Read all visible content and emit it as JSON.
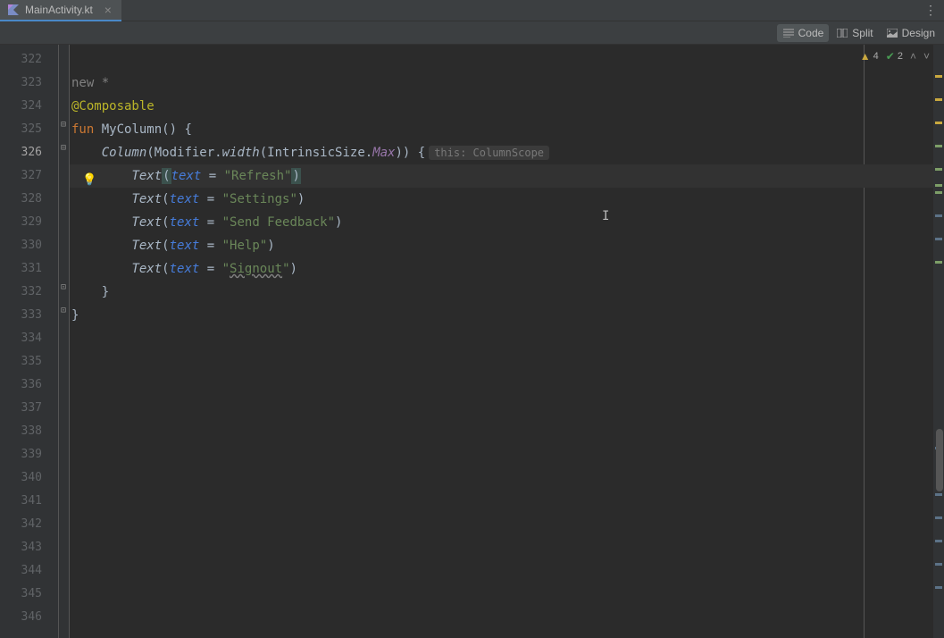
{
  "tab": {
    "filename": "MainActivity.kt"
  },
  "views": {
    "code": "Code",
    "split": "Split",
    "design": "Design"
  },
  "status": {
    "warnings": "4",
    "checks": "2"
  },
  "gutter": {
    "start": 322,
    "end": 346,
    "active": 326
  },
  "code": {
    "l322": "",
    "l323_comment": "new *",
    "l324_annotation": "@Composable",
    "l325_fun": "fun",
    "l325_name": "MyColumn",
    "l325_rest": "() {",
    "l326_column": "Column",
    "l326_modifier": "(Modifier.",
    "l326_width": "width",
    "l326_intrinsic": "(IntrinsicSize.",
    "l326_max": "Max",
    "l326_close": ")) {",
    "l326_hint": "this: ColumnScope",
    "l327_text": "Text",
    "l327_param": "text",
    "l327_eq": " = ",
    "l327_str": "\"Refresh\"",
    "l328_str": "\"Settings\"",
    "l329_str": "\"Send Feedback\"",
    "l330_str": "\"Help\"",
    "l331_str_open": "\"",
    "l331_signout": "Signout",
    "l331_str_close": "\"",
    "l332_brace": "    }",
    "l333_brace": "}"
  }
}
